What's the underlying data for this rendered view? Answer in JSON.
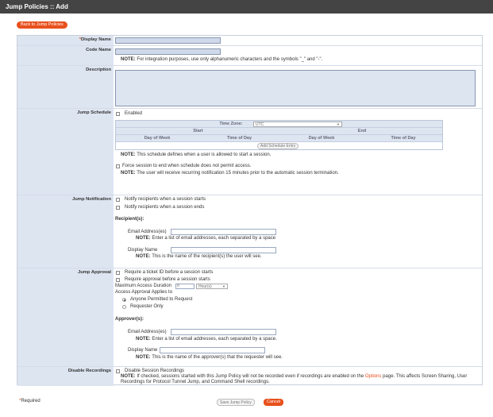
{
  "title": "Jump Policies :: Add",
  "back_button": "Back to Jump Policies",
  "display_name": {
    "label": "Display Name",
    "required_marker": "*",
    "value": ""
  },
  "code_name": {
    "label": "Code Name",
    "value": "",
    "note_bold": "NOTE:",
    "note": " For integration purposes, use only alphanumeric characters and the symbols \"_\" and \"-\"."
  },
  "description": {
    "label": "Description",
    "value": ""
  },
  "jump_schedule": {
    "label": "Jump Schedule",
    "enabled_label": "Enabled",
    "timezone_label": "Time Zone:",
    "timezone_value": "UTC",
    "start_label": "Start",
    "end_label": "End",
    "day_of_week": "Day of Week",
    "time_of_day": "Time of Day",
    "add_entry": "Add Schedule Entry",
    "note1_bold": "NOTE:",
    "note1": " This schedule defines when a user is allowed to start a session.",
    "force_label": "Force session to end when schedule does not permit access.",
    "note2_bold": "NOTE:",
    "note2": " The user will receive recurring notification 15 minutes prior to the automatic session termination."
  },
  "jump_notification": {
    "label": "Jump Notification",
    "notify_start": "Notify recipients when a session starts",
    "notify_end": "Notify recipients when a session ends",
    "recipients_heading": "Recipient(s):",
    "email_label": "Email Address(es)",
    "email_value": "",
    "email_note_bold": "NOTE:",
    "email_note": " Enter a list of email addresses, each separated by a space",
    "display_label": "Display Name",
    "display_value": "",
    "display_note_bold": "NOTE:",
    "display_note": " This is the name of the recipient(s) the user will see."
  },
  "jump_approval": {
    "label": "Jump Approval",
    "require_ticket": "Require a ticket ID before a session starts",
    "require_approval": "Require approval before a session starts",
    "max_duration_label": "Maximum Access Duration",
    "max_duration_value": "8",
    "duration_unit": "Hour(s)",
    "applies_to_label": "Access Approval Applies to",
    "option_anyone": "Anyone Permitted to Request",
    "option_requester": "Requester Only",
    "approvers_heading": "Approver(s):",
    "email_label": "Email Address(es)",
    "email_value": "",
    "email_note_bold": "NOTE:",
    "email_note": " Enter a list of email addresses, each separated by a space.",
    "display_label": "Display Name",
    "display_value": "",
    "display_note_bold": "NOTE:",
    "display_note": " This is the name of the approver(s) that the requester will see."
  },
  "disable_recordings": {
    "label": "Disable Recordings",
    "checkbox_label": "Disable Session Recordings",
    "note_bold": "NOTE:",
    "note_pre": " If checked, sessions started with this Jump Policy will not be recorded even if recordings are enabled on the ",
    "note_link": "Options",
    "note_post": " page. This affects Screen Sharing, User",
    "note_line2": "Recordings for Protocol Tunnel Jump, and Command Shell recordings."
  },
  "footer": {
    "required_marker": "*",
    "required_text": "Required",
    "save_button": "Save Jump Policy",
    "cancel_button": "Cancel"
  },
  "colors": {
    "accent": "#e8501c",
    "header_bg": "#444444",
    "label_bg": "#dde5f1"
  }
}
